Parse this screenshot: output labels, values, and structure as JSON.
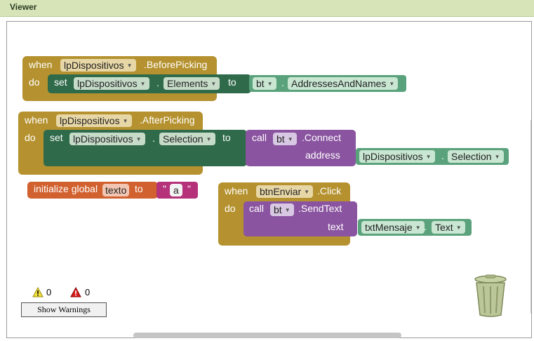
{
  "header": {
    "title": "Viewer"
  },
  "block1": {
    "when": "when",
    "component": "lpDispositivos",
    "event": ".BeforePicking",
    "do": "do",
    "set": "set",
    "set_component": "lpDispositivos",
    "dot": ".",
    "property": "Elements",
    "to": "to",
    "value_component": "bt",
    "value_property": "AddressesAndNames"
  },
  "block2": {
    "when": "when",
    "component": "lpDispositivos",
    "event": ".AfterPicking",
    "do": "do",
    "set": "set",
    "set_component": "lpDispositivos",
    "dot": ".",
    "property": "Selection",
    "to": "to",
    "call": "call",
    "call_component": "bt",
    "method": ".Connect",
    "address_label": "address",
    "arg_component": "lpDispositivos",
    "arg_property": "Selection"
  },
  "block3": {
    "initialize": "initialize global",
    "var_name": "texto",
    "to": "to",
    "quote_open": "\"",
    "string_value": "a",
    "quote_close": "\""
  },
  "block4": {
    "when": "when",
    "component": "btnEnviar",
    "event": ".Click",
    "do": "do",
    "call": "call",
    "call_component": "bt",
    "method": ".SendText",
    "text_label": "text",
    "arg_component": "txtMensaje",
    "arg_property": "Text"
  },
  "warnings": {
    "warning_count": "0",
    "error_count": "0",
    "button_label": "Show Warnings"
  },
  "colors": {
    "event": "#b5922f",
    "set": "#2f6b4a",
    "component": "#5aa27c",
    "call": "#8a54a0",
    "variable": "#d1612f",
    "text": "#b5327a"
  }
}
